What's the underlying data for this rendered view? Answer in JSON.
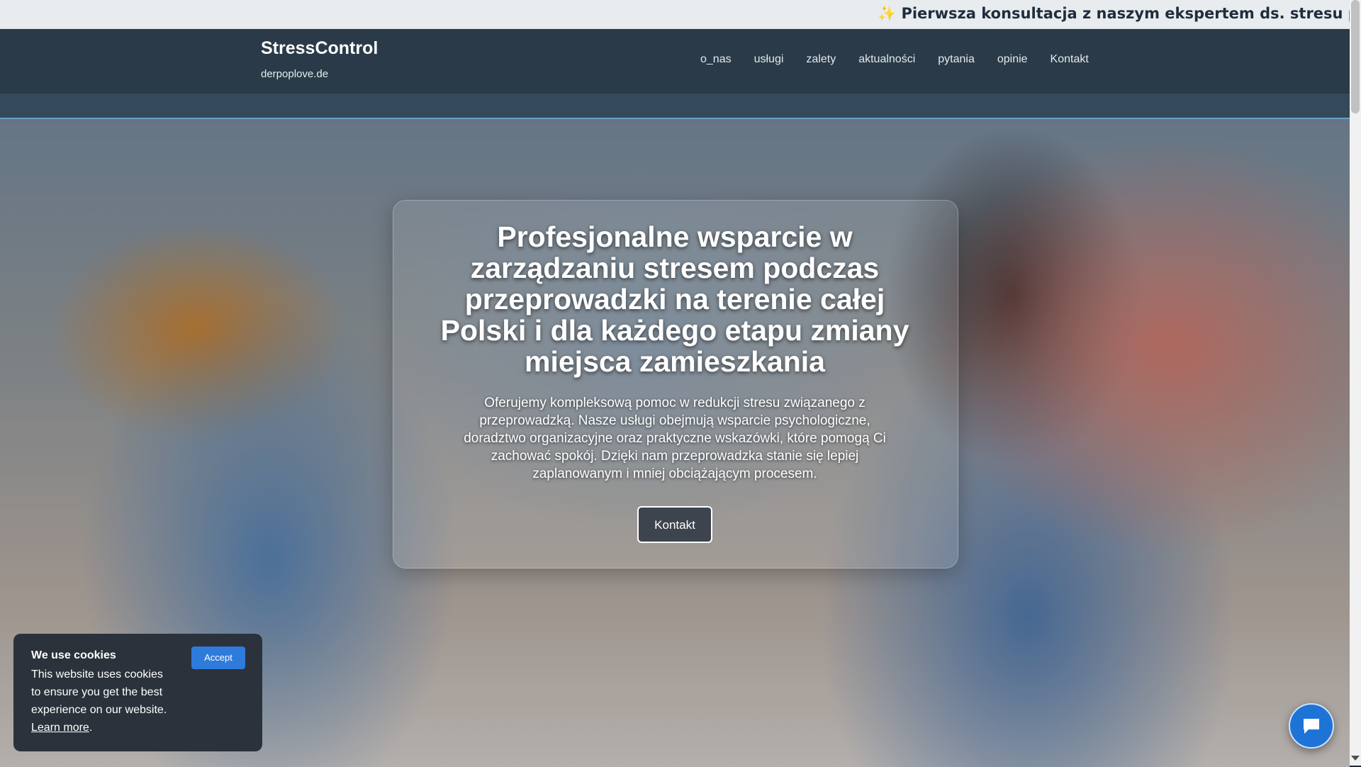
{
  "announcement": {
    "text": "✨ Pierwsza konsultacja z naszym ekspertem ds. stresu prz"
  },
  "header": {
    "brand_title": "StressControl",
    "brand_subtitle": "derpoplove.de",
    "nav": [
      {
        "label": "o_nas"
      },
      {
        "label": "usługi"
      },
      {
        "label": "zalety"
      },
      {
        "label": "aktualności"
      },
      {
        "label": "pytania"
      },
      {
        "label": "opinie"
      },
      {
        "label": "Kontakt"
      }
    ]
  },
  "hero": {
    "title": "Profesjonalne wsparcie w zarządzaniu stresem podczas przeprowadzki na terenie całej Polski i dla każdego etapu zmiany miejsca zamieszkania",
    "text": "Oferujemy kompleksową pomoc w redukcji stresu związanego z przeprowadzką. Nasze usługi obejmują wsparcie psychologiczne, doradztwo organizacyjne oraz praktyczne wskazówki, które pomogą Ci zachować spokój. Dzięki nam przeprowadzka stanie się lepiej zaplanowanym i mniej obciążającym procesem.",
    "button_label": "Kontakt"
  },
  "cookie": {
    "title": "We use cookies",
    "text": "This website uses cookies to ensure you get the best experience on our website.",
    "learn_more": "Learn more",
    "period": ".",
    "accept_label": "Accept"
  },
  "chat": {
    "icon": "chat-bubble-icon"
  },
  "colors": {
    "header_bg": "#2a3a48",
    "accent_button": "#2f7bdc",
    "chat_button": "#1e74d6"
  }
}
